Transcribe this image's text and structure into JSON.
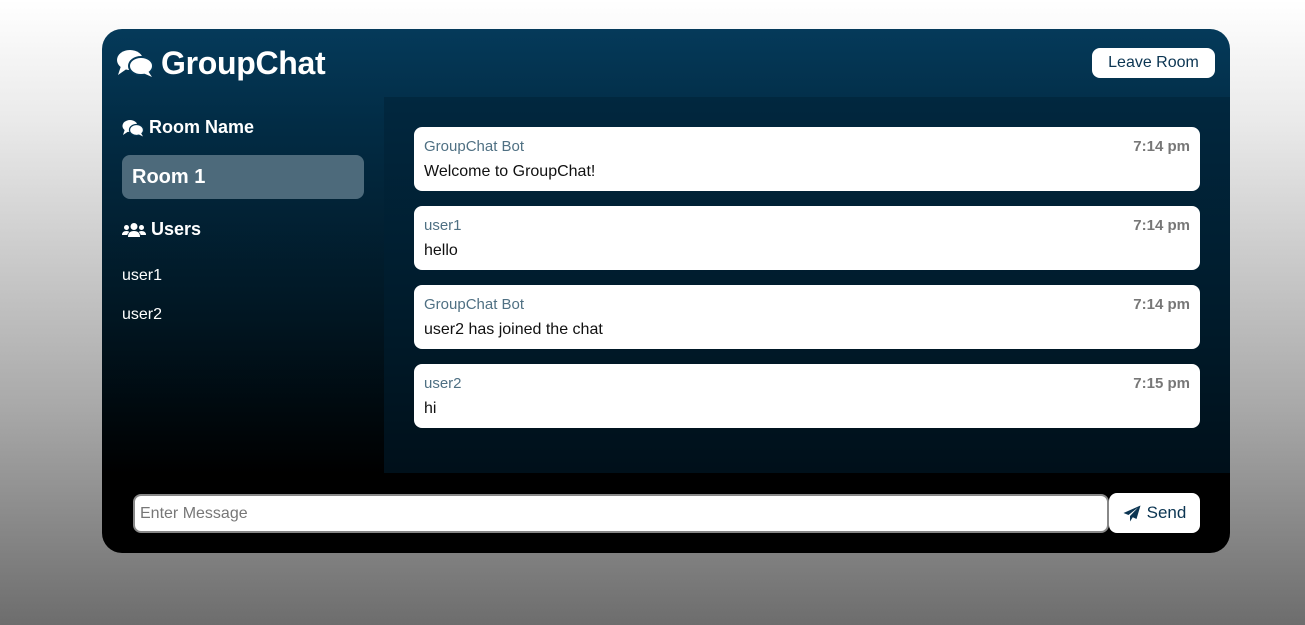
{
  "header": {
    "app_title": "GroupChat",
    "logo_icon": "comments-icon",
    "leave_button_label": "Leave Room"
  },
  "sidebar": {
    "room_heading": "Room Name",
    "room_heading_icon": "comments-icon",
    "room_name": "Room 1",
    "users_heading": "Users",
    "users_heading_icon": "users-icon",
    "users": [
      "user1",
      "user2"
    ]
  },
  "messages": [
    {
      "user": "GroupChat Bot",
      "time": "7:14 pm",
      "text": "Welcome to GroupChat!"
    },
    {
      "user": "user1",
      "time": "7:14 pm",
      "text": "hello"
    },
    {
      "user": "GroupChat Bot",
      "time": "7:14 pm",
      "text": "user2 has joined the chat"
    },
    {
      "user": "user2",
      "time": "7:15 pm",
      "text": "hi"
    }
  ],
  "composer": {
    "input_placeholder": "Enter Message",
    "input_value": "",
    "send_label": "Send",
    "send_icon": "paper-plane-icon"
  },
  "colors": {
    "brand_dark": "#053a5a",
    "sidebar_room_bg": "#4d6a7b",
    "username_text": "#4f7083"
  }
}
